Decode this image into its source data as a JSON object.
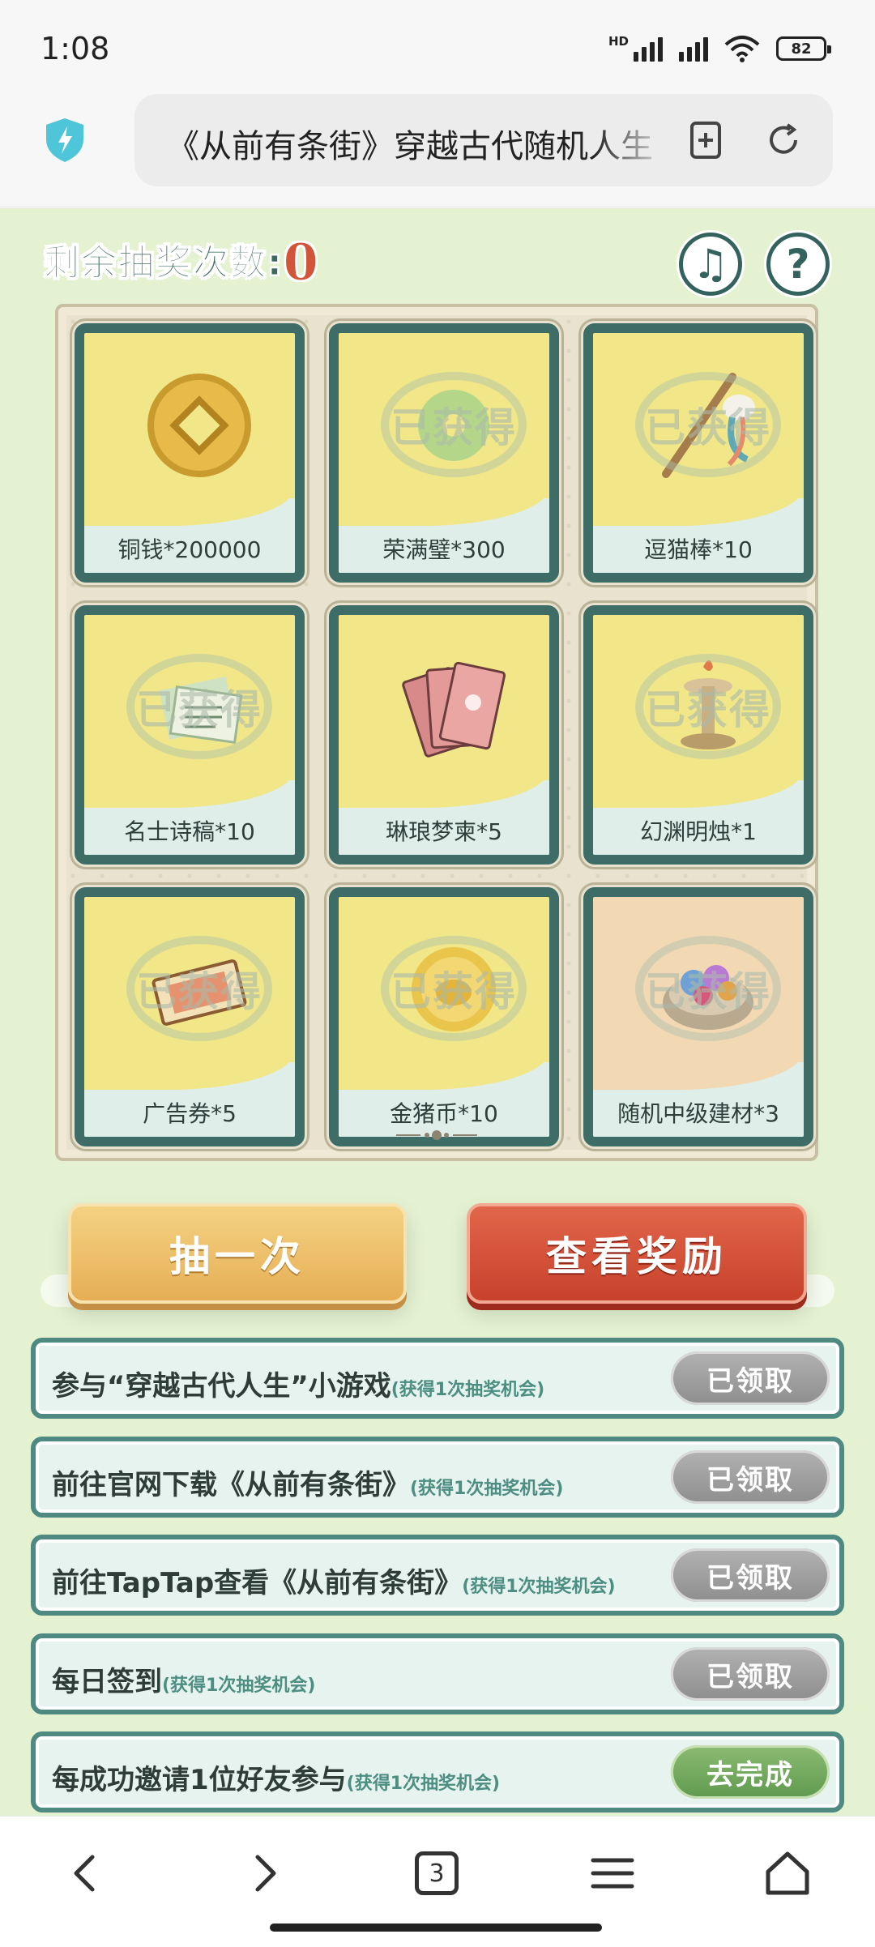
{
  "status_bar": {
    "time": "1:08",
    "network_label": "HD",
    "battery": "82"
  },
  "browser": {
    "url_text": "《从前有条街》穿越古代随机人生",
    "icons": [
      "shield-icon",
      "add-tab-icon",
      "refresh-icon"
    ]
  },
  "lottery": {
    "remaining_label": "剩余抽奖次数:",
    "remaining_count": "0",
    "obtained_text": "已获得",
    "music_icon": "music-note-icon",
    "help_icon": "question-icon",
    "help_glyph": "?",
    "music_glyph": "♫",
    "prizes": [
      {
        "name": "铜钱*200000",
        "icon": "copper-coin-icon",
        "obtained": false
      },
      {
        "name": "荣满璧*300",
        "icon": "jade-disc-icon",
        "obtained": true
      },
      {
        "name": "逗猫棒*10",
        "icon": "cat-teaser-icon",
        "obtained": true
      },
      {
        "name": "名士诗稿*10",
        "icon": "poetry-scroll-icon",
        "obtained": true
      },
      {
        "name": "琳琅梦柬*5",
        "icon": "dream-cards-icon",
        "obtained": false
      },
      {
        "name": "幻渊明烛*1",
        "icon": "candle-icon",
        "obtained": true
      },
      {
        "name": "广告券*5",
        "icon": "ad-ticket-icon",
        "obtained": true
      },
      {
        "name": "金猪币*10",
        "icon": "gold-pig-coin-icon",
        "obtained": true
      },
      {
        "name": "随机中级建材*3",
        "icon": "building-materials-icon",
        "obtained": true
      }
    ],
    "draw_once_label": "抽一次",
    "view_rewards_label": "查看奖励"
  },
  "tasks": [
    {
      "title": "参与“穿越古代人生”小游戏",
      "sub": "(获得1次抽奖机会)",
      "button": "已领取",
      "status": "done"
    },
    {
      "title": "前往官网下载《从前有条街》",
      "sub": "(获得1次抽奖机会)",
      "button": "已领取",
      "status": "done"
    },
    {
      "title": "前往TapTap查看《从前有条街》",
      "sub": "(获得1次抽奖机会)",
      "button": "已领取",
      "status": "done"
    },
    {
      "title": "每日签到",
      "sub": "(获得1次抽奖机会)",
      "button": "已领取",
      "status": "done"
    },
    {
      "title": "每成功邀请1位好友参与",
      "sub": "(获得1次抽奖机会)",
      "button": "去完成",
      "status": "todo"
    }
  ],
  "nav": {
    "tab_count": "3",
    "icons": [
      "back-icon",
      "forward-icon",
      "tabs-icon",
      "menu-icon",
      "home-icon"
    ]
  }
}
